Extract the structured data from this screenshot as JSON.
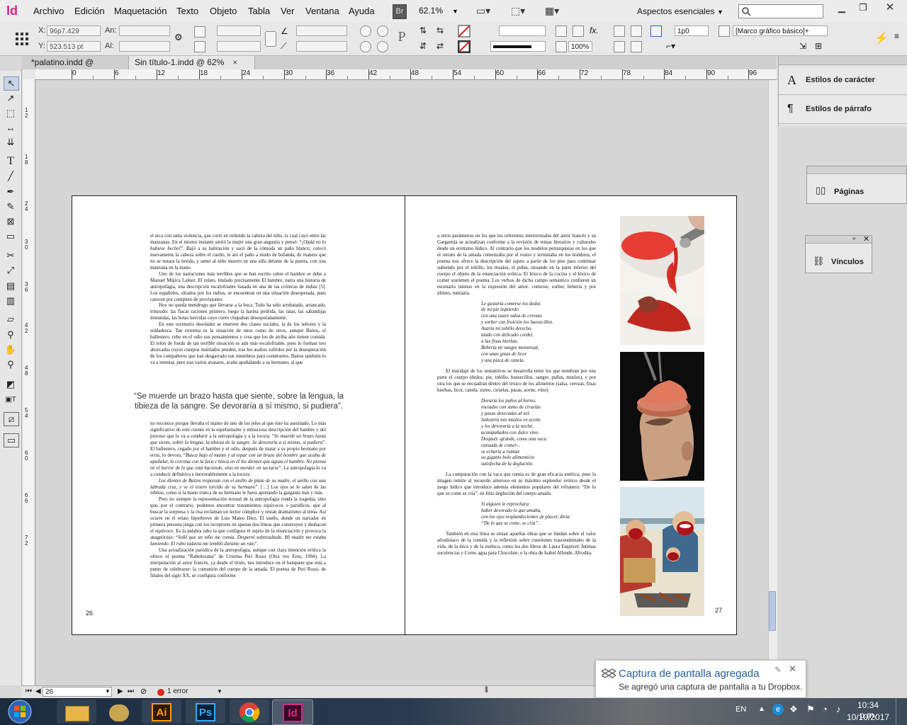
{
  "app": {
    "logo": "Id",
    "menu": [
      "Archivo",
      "Edición",
      "Maquetación",
      "Texto",
      "Objeto",
      "Tabla",
      "Ver",
      "Ventana",
      "Ayuda"
    ],
    "bridge_label": "Br",
    "zoom": "62.1%",
    "workspace": "Aspectos esenciales",
    "search_placeholder": ""
  },
  "control": {
    "x_label": "X:",
    "x_value": "96p7.429",
    "y_label": "Y:",
    "y_value": "523.513 pt",
    "w_label": "An:",
    "h_label": "Al:",
    "stroke_weight": "1p0",
    "object_style": "[Marco gráfico básico]+",
    "scale_pct": "100%"
  },
  "tabs": [
    {
      "label": "*palatino.indd @ 91%",
      "close": "×"
    },
    {
      "label": "Sin título-1.indd @ 62%",
      "close": "×"
    }
  ],
  "rulers": {
    "h_ticks": [
      "0",
      "6",
      "12",
      "18",
      "24",
      "30",
      "36",
      "42",
      "48",
      "54",
      "60",
      "66",
      "72",
      "78",
      "84",
      "90",
      "96"
    ],
    "v_ticks": [
      "1 2",
      "1 8",
      "2 4",
      "3 0",
      "3 6",
      "0",
      "4 2",
      "4 8",
      "5 4",
      "6 0",
      "6 6",
      "7 2"
    ]
  },
  "page_left": {
    "p1": "el arca con tanta violencia, que cortó en redondo la cabeza del niño, la cual cayó entre las manzanas. En el mismo instante sintió la mujer una gran angustia y pensó: “",
    "p1_it": "¡Ojalá no lo hubiese hecho!",
    "p1b": "”. Bajó a su habitación y sacó de la cómoda un paño blanco; colocó nuevamente la cabeza sobre el cuello, le ató el paño a modo de bufanda, de manera que no se notara la herida, y sentó al niño muerto en una silla delante de la puerta, con una manzana en la mano.",
    "p2": "Uno de los narraciones más terribles que se han escrito sobre el hambre se debe a Manuel Mújica Laínez. El relato, titulado precisamente El hambre, narra una historia de antropofagia, una descripción escalofriante basada en una de las crónicas de indias [5]. Los españoles, sitiados por los indios, se encuentran en una situación desesperada, pues carecen por completo de provisiones:",
    "p3": "Hoy no queda mendrugo que llevarse a la boca. Todo ha sido arrebatado, arrancado, triturado: las flacas raciones primero, luego la harina podrida, las ratas, las sabandijas inmundas, las botas hervidas cuyo cuero chupaban desesperadamente.",
    "p4": "En este escenario desolador se mueven dos clases sociales, la de los señores y la soldadesca. Tan extrema es la situación de unos como de otros, aunque Baitos, el ballestero, cebe en el odio sus pensamientos y crea que los de arriba aún tienen comida. El telón de fondo de tan terrible situación es aún más escalofriante, pues lo forman tres ahorcados cuyos cuerpos mutilados penden, tras los asaltos sufridos por la desesperación de los compañeros que han desgarrado sus miembros para comérselos. Baitos también lo va a intentar, pero tras varios avatares, acaba apuñalando a su hermano, al que",
    "pull_quote": "“Se muerde un brazo hasta que siente, sobre la lengua, la tibieza de la sangre. Se devoraría a sí mismo, si pudiera”.",
    "p5": "no reconoce porque llevaba el manto de uno de los jefes al que éste ha asesinado. Lo más significativo de este cuento es la espeluznante y minuciosa descripción del hambre y del proceso que lo va a conducir a la antropofagia y a la locura: “",
    "p5_it": "Se muerde un brazo hasta que siente, sobre la lengua, la tibieza de la sangre. Se devoraría a sí mismo, si pudiera",
    "p5b": "”. El ballestero, cegado por el hambre y el odio, después de matar a su propio hermano por error, lo devora: “",
    "p5_it2": "Busca bajo el manto y al topar con un brazo del hombre que acaba de apuñalar, lo cercena con la faca e hinca en él los dientes que aguza el hambre. No piensa en el horror de lo que está haciendo, sino en morder, en saciarse",
    "p5c": "”. La antropofagia lo va a conducir definitiva e inexorablemente a la locura:",
    "p6_it": "Los dientes de Baitos tropiezan con el anillo de plata de su madre, el anillo con una labrada cruz, y ve el rostro torcido de su hermano",
    "p6": "”. […] Los ojos se le salen de las órbitas, como si la mano trunca de su hermano le fuera apretando la garganta más y más.",
    "p7": "Pero no siempre la representación textual de la antropofagia ronda la tragedia, sino que, por el contrario, podemos encontrar tratamientos equívocos o paródicos, que al buscar la sorpresa y la risa reclaman un lector cómplice y restan dramatismo al tema. Así ocurre en el relato hiperbreve de Luis Mateo Díez, El sueño, donde un narrador en primera persona juega con los receptores en apenas dos líneas que construyen y deshacen el equívoco. Es la palabra rabo la que configura el sujeto de la enunciación y provoca la anagnórisis: “",
    "p7_it": "Soñé que un niño me comía. Desperté sobresaltado. Mi madre me estaba lamiendo. El rabo todavía me tembló durante un rato",
    "p7b": "”.",
    "p8": "Una actualización paródica de la antropofagia, aunque con clara intención erótica la ofrece el poema “Rabelesiana” de Cristina Peri Rossi (Otra vez Eros, 1994). La interpelación al autor francés, ya desde el título, nos introduce en el banquete que está a punto de celebrarse: la comunión del cuerpo de la amada. El poema de Peri Rossi, de finales del siglo XX, se configura conforme",
    "folio": "26"
  },
  "page_right": {
    "p1": "a otros parámetros en los que los referentes intertextuales del autor francés y su Gargantúa se actualizan conforme a la revisión de temas literarios y culturales desde un erotismo lúdico. Al contrario que los modelos petrarquistas en los que el retrato de la amada comenzaba por el rostro y terminaba en los hombros, el poema nos ofrece la descripción del sujeto a partir de los pies para continuar subiendo por el tobillo, los muslos, el pubis, situando en la parte inferior del cuerpo el objeto de la enunciación erótica. El léxico de la cocina y el léxico de comer sostienen el poema. Los verbos de dicho campo semántico confieren un escenario intenso en la expresión del amor: comerse, sorber, bebería y por último, rumiaría.",
    "poem1": [
      "Le gustaría comerse los dedos",
      "de mi pie izquierdo",
      "con una suave salsa de cerezas",
      "y sorber con fruición los huesecillos.",
      "Asaría mi tobillo derecho,",
      "atado con delicado cordel,",
      "a las finas hierbas.",
      "Bebería mi sangre menstrual,",
      "con unas gotas de licor",
      "y una pizca de canela."
    ],
    "p2": "El maridaje de los sustantivos se desarrolla entre los que nombran por una parte el cuerpo (dedos, pie, tobillo, huesecillos, sangre, puños, muslos), y por otra los que se encuadran dentro del léxico de los alimentos (salsa, cerezas, finas hierbas, licor, canela, zumo, ciruelas, pasas, aceite, vino).",
    "poem2": [
      "Doraría los puños al horno,",
      "rociados con zumo de ciruelas",
      "y pasas desecadas al sol.",
      "Saltearía mis muslos en aceite",
      "y los devoraría a la noche,",
      "acompañados con dulce vino.",
      "Después -grande, como una vaca",
      "cansada de comer-,",
      "se echaría a rumiar",
      "su gigante bolo alimenticio",
      "satisfecha de la deglución."
    ],
    "p3": "La comparación con la vaca que rumia es de gran eficacia estética, pues la imagen remite al recuerdo amoroso en su máximo esplendor erótico desde el juego lúdico que introduce además elementos populares del refranero: “De lo que se come se cría”, en feliz deglución del cuerpo amado.",
    "poem3": [
      "Si alguien le reprochara",
      "haber devorado lo que amaba,",
      "con los ojos resplandecientes de placer, diría:",
      "“De lo que se come, se cría”."
    ],
    "p4": "También en esta línea se sitúan aquellas obras que se fundan sobre el valor afrodisíaco de la comida y la reflexión sobre cuestiones trascendentales de la vida, de la ética y de la estética, como los dos libros de Laura Esquivel: Íntimas suculencias y Como agua para Chocolate, o la obra de Isabel Allende, Afrodita.",
    "folio": "27"
  },
  "panels": {
    "char_styles": "Estilos de carácter",
    "para_styles": "Estilos de párrafo",
    "pages": "Páginas",
    "links": "Vínculos"
  },
  "status": {
    "page_field": "26",
    "errors": "1 error"
  },
  "toast": {
    "title": "Captura de pantalla agregada",
    "body": "Se agregó una captura de pantalla a tu Dropbox."
  },
  "taskbar": {
    "lang": "EN",
    "time": "10:34 p.m.",
    "date": "10/10/2017",
    "apps": [
      "explorer",
      "illustrator",
      "photoshop",
      "chrome",
      "indesign"
    ],
    "ai_label": "Ai",
    "ps_label": "Ps",
    "id_label": "Id"
  },
  "colors": {
    "indesign": "#d9258a",
    "illustrator": "#ff9a00",
    "photoshop": "#31a8ff",
    "dropbox": "#0061fe",
    "error_dot": "#e0241b"
  }
}
